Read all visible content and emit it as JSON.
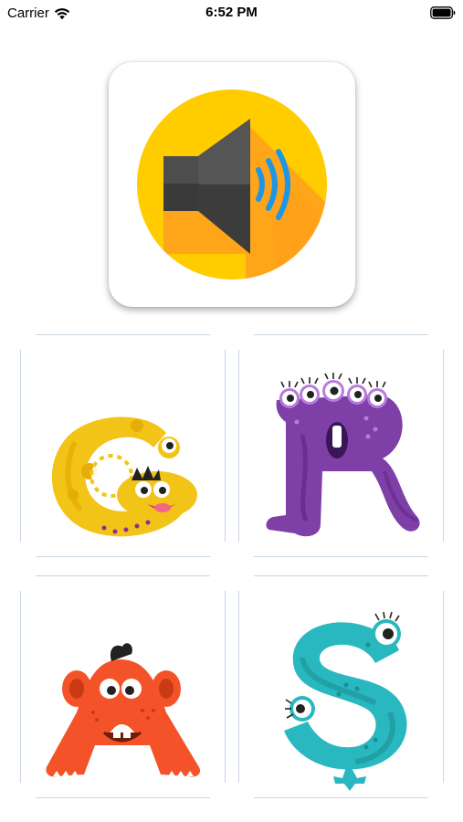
{
  "status_bar": {
    "carrier": "Carrier",
    "time": "6:52 PM",
    "wifi_icon": "wifi-icon",
    "battery_icon": "battery-icon"
  },
  "sound_button": {
    "icon": "speaker-volume-icon",
    "colors": {
      "circle": "#FFCC00",
      "shadow": "#FFA21A",
      "speaker": "#4A4A4A",
      "waves": "#1E96E6"
    }
  },
  "letter_cards": [
    {
      "letter": "C",
      "icon": "monster-letter-c-icon",
      "color": "#F2C418"
    },
    {
      "letter": "R",
      "icon": "monster-letter-r-icon",
      "color": "#7E3FA6"
    },
    {
      "letter": "A",
      "icon": "monster-letter-a-icon",
      "color": "#F4532A"
    },
    {
      "letter": "S",
      "icon": "monster-letter-s-icon",
      "color": "#29B8BF"
    }
  ]
}
